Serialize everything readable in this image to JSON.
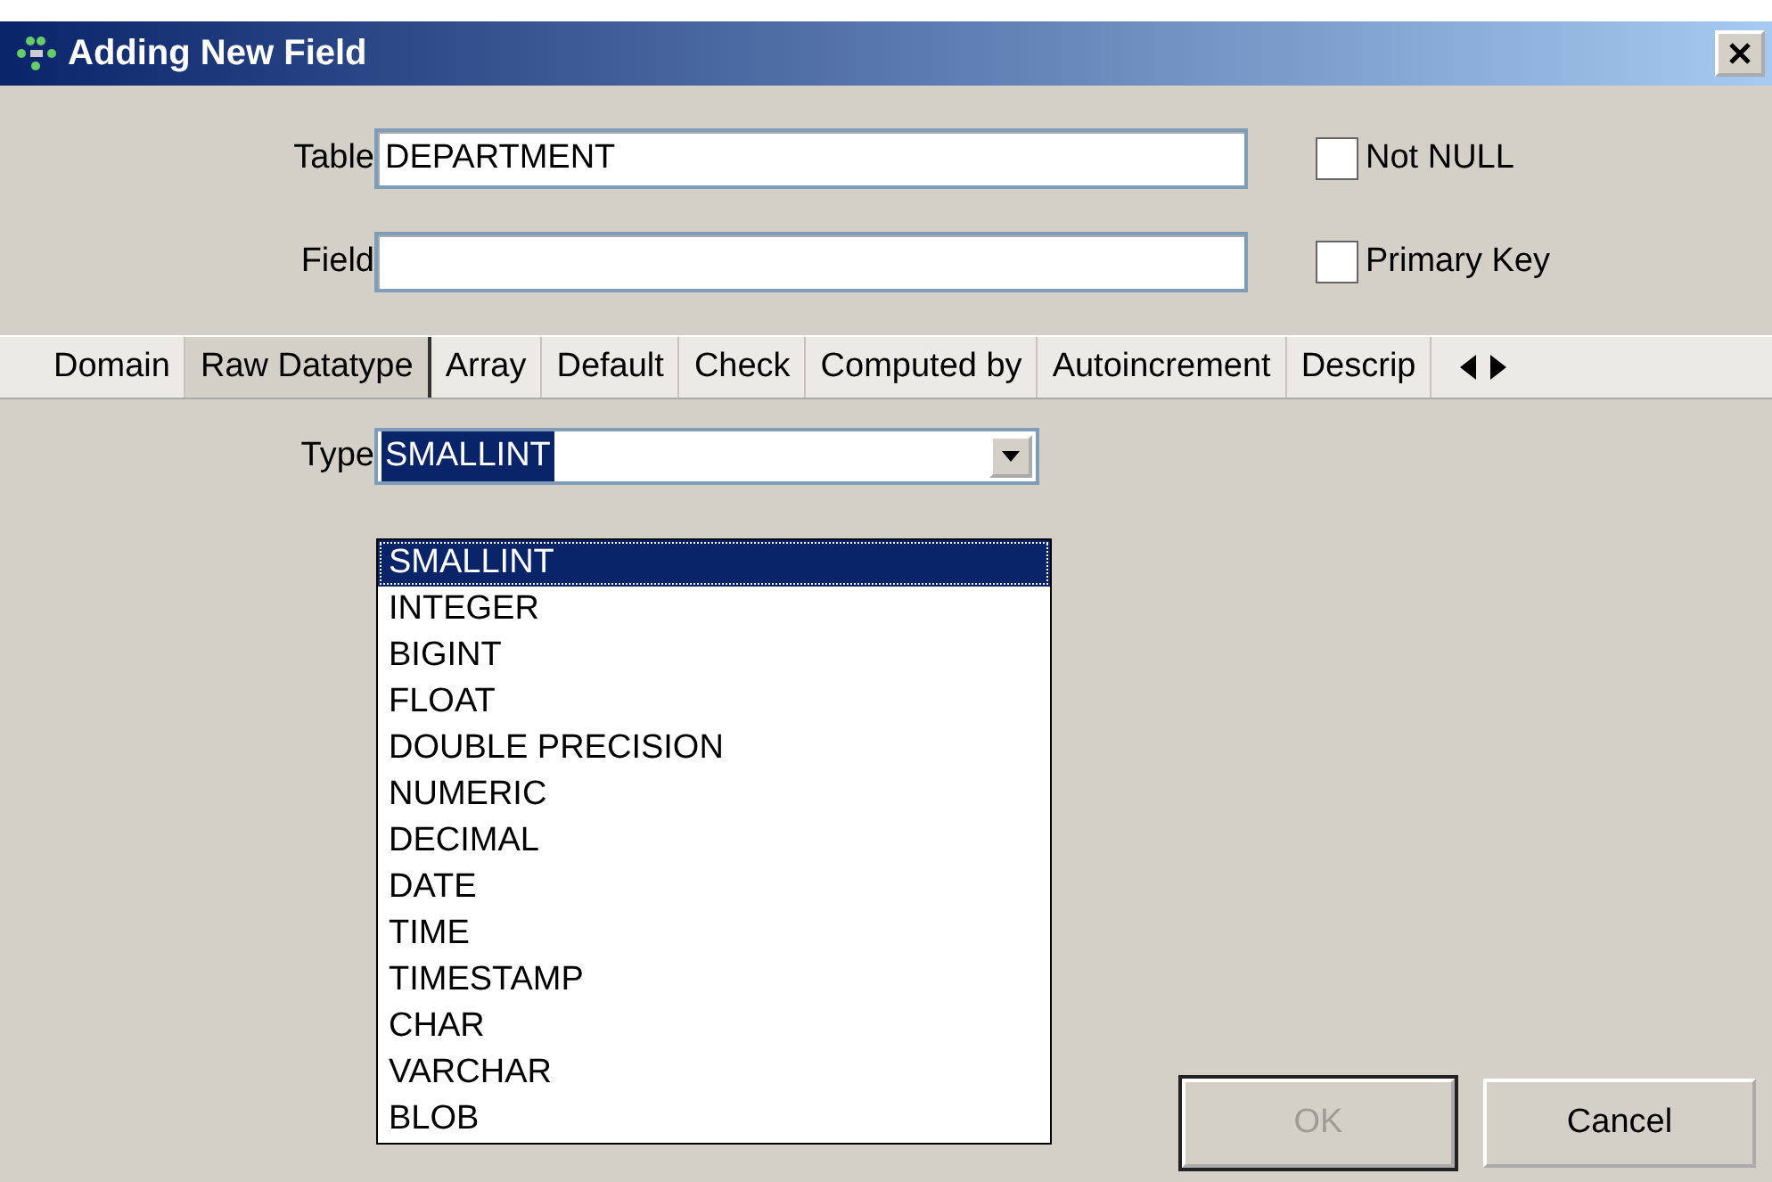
{
  "window": {
    "title": "Adding New Field"
  },
  "fields": [
    {
      "label": "Table",
      "value": "DEPARTMENT",
      "option": {
        "label": "Not NULL",
        "checked": false
      }
    },
    {
      "label": "Field",
      "option": {
        "label": "Primary Key",
        "checked": false
      }
    }
  ],
  "tabs": [
    {
      "label": "Domain",
      "selected": false
    },
    {
      "label": "Raw Datatype",
      "selected": true
    },
    {
      "label": "Array",
      "selected": false
    },
    {
      "label": "Default",
      "selected": false
    },
    {
      "label": "Check",
      "selected": false
    },
    {
      "label": "Computed by",
      "selected": false
    },
    {
      "label": "Autoincrement",
      "selected": false
    },
    {
      "label": "Descrip",
      "selected": false
    }
  ],
  "type_field": {
    "label": "Type",
    "value": "SMALLINT",
    "expanded": true
  },
  "dropdown": {
    "items": [
      {
        "label": "SMALLINT",
        "selected": true
      },
      {
        "label": "INTEGER",
        "selected": false
      },
      {
        "label": "BIGINT",
        "selected": false
      },
      {
        "label": "FLOAT",
        "selected": false
      },
      {
        "label": "DOUBLE PRECISION",
        "selected": false
      },
      {
        "label": "NUMERIC",
        "selected": false
      },
      {
        "label": "DECIMAL",
        "selected": false
      },
      {
        "label": "DATE",
        "selected": false
      },
      {
        "label": "TIME",
        "selected": false
      },
      {
        "label": "TIMESTAMP",
        "selected": false
      },
      {
        "label": "CHAR",
        "selected": false
      },
      {
        "label": "VARCHAR",
        "selected": false
      },
      {
        "label": "BLOB",
        "selected": false
      }
    ]
  },
  "buttons": [
    {
      "label": "OK",
      "disabled": true,
      "default": true
    },
    {
      "label": "Cancel",
      "disabled": false,
      "default": false
    }
  ]
}
